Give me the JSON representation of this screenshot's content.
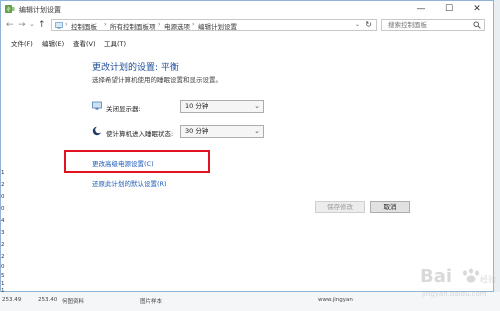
{
  "window": {
    "title": "编辑计划设置",
    "controls": {
      "minimize": "—",
      "maximize": "☐",
      "close": "✕"
    }
  },
  "nav": {
    "back": "←",
    "forward": "→",
    "recent": "⌄",
    "up": "↑",
    "breadcrumbs": [
      "控制面板",
      "所有控制面板项",
      "电源选项",
      "编辑计划设置"
    ],
    "separator": "›",
    "dropdown": "⌄",
    "refresh": "↻",
    "search_placeholder": "搜索控制面板"
  },
  "menu": [
    "文件(F)",
    "编辑(E)",
    "查看(V)",
    "工具(T)"
  ],
  "content": {
    "title": "更改计划的设置: 平衡",
    "subtitle": "选择希望计算机使用的睡眠设置和显示设置。",
    "settings": [
      {
        "label": "关闭显示器:",
        "value": "10 分钟",
        "icon": "monitor-icon"
      },
      {
        "label": "使计算机进入睡眠状态:",
        "value": "30 分钟",
        "icon": "moon-icon"
      }
    ],
    "advanced_link": "更改高级电源设置(C)",
    "restore_link": "还原此计划的默认设置(R)"
  },
  "buttons": {
    "save": "保存修改",
    "cancel": "取消"
  },
  "background": {
    "left_digits": [
      "1",
      "2",
      "0",
      "0",
      "4",
      "3",
      "2",
      "2",
      "0",
      "5",
      "1",
      "1"
    ],
    "bottom_cells": [
      "253.49",
      "253.40",
      "何图资料",
      "图片样本",
      "www.jingyan"
    ]
  },
  "colors": {
    "accent": "#1e4e9a",
    "link": "#1b5bb8",
    "highlight": "#e2131f"
  },
  "watermark": {
    "brand": "Bai",
    "suffix": "经验",
    "url": "jingyan.baidu.com"
  }
}
